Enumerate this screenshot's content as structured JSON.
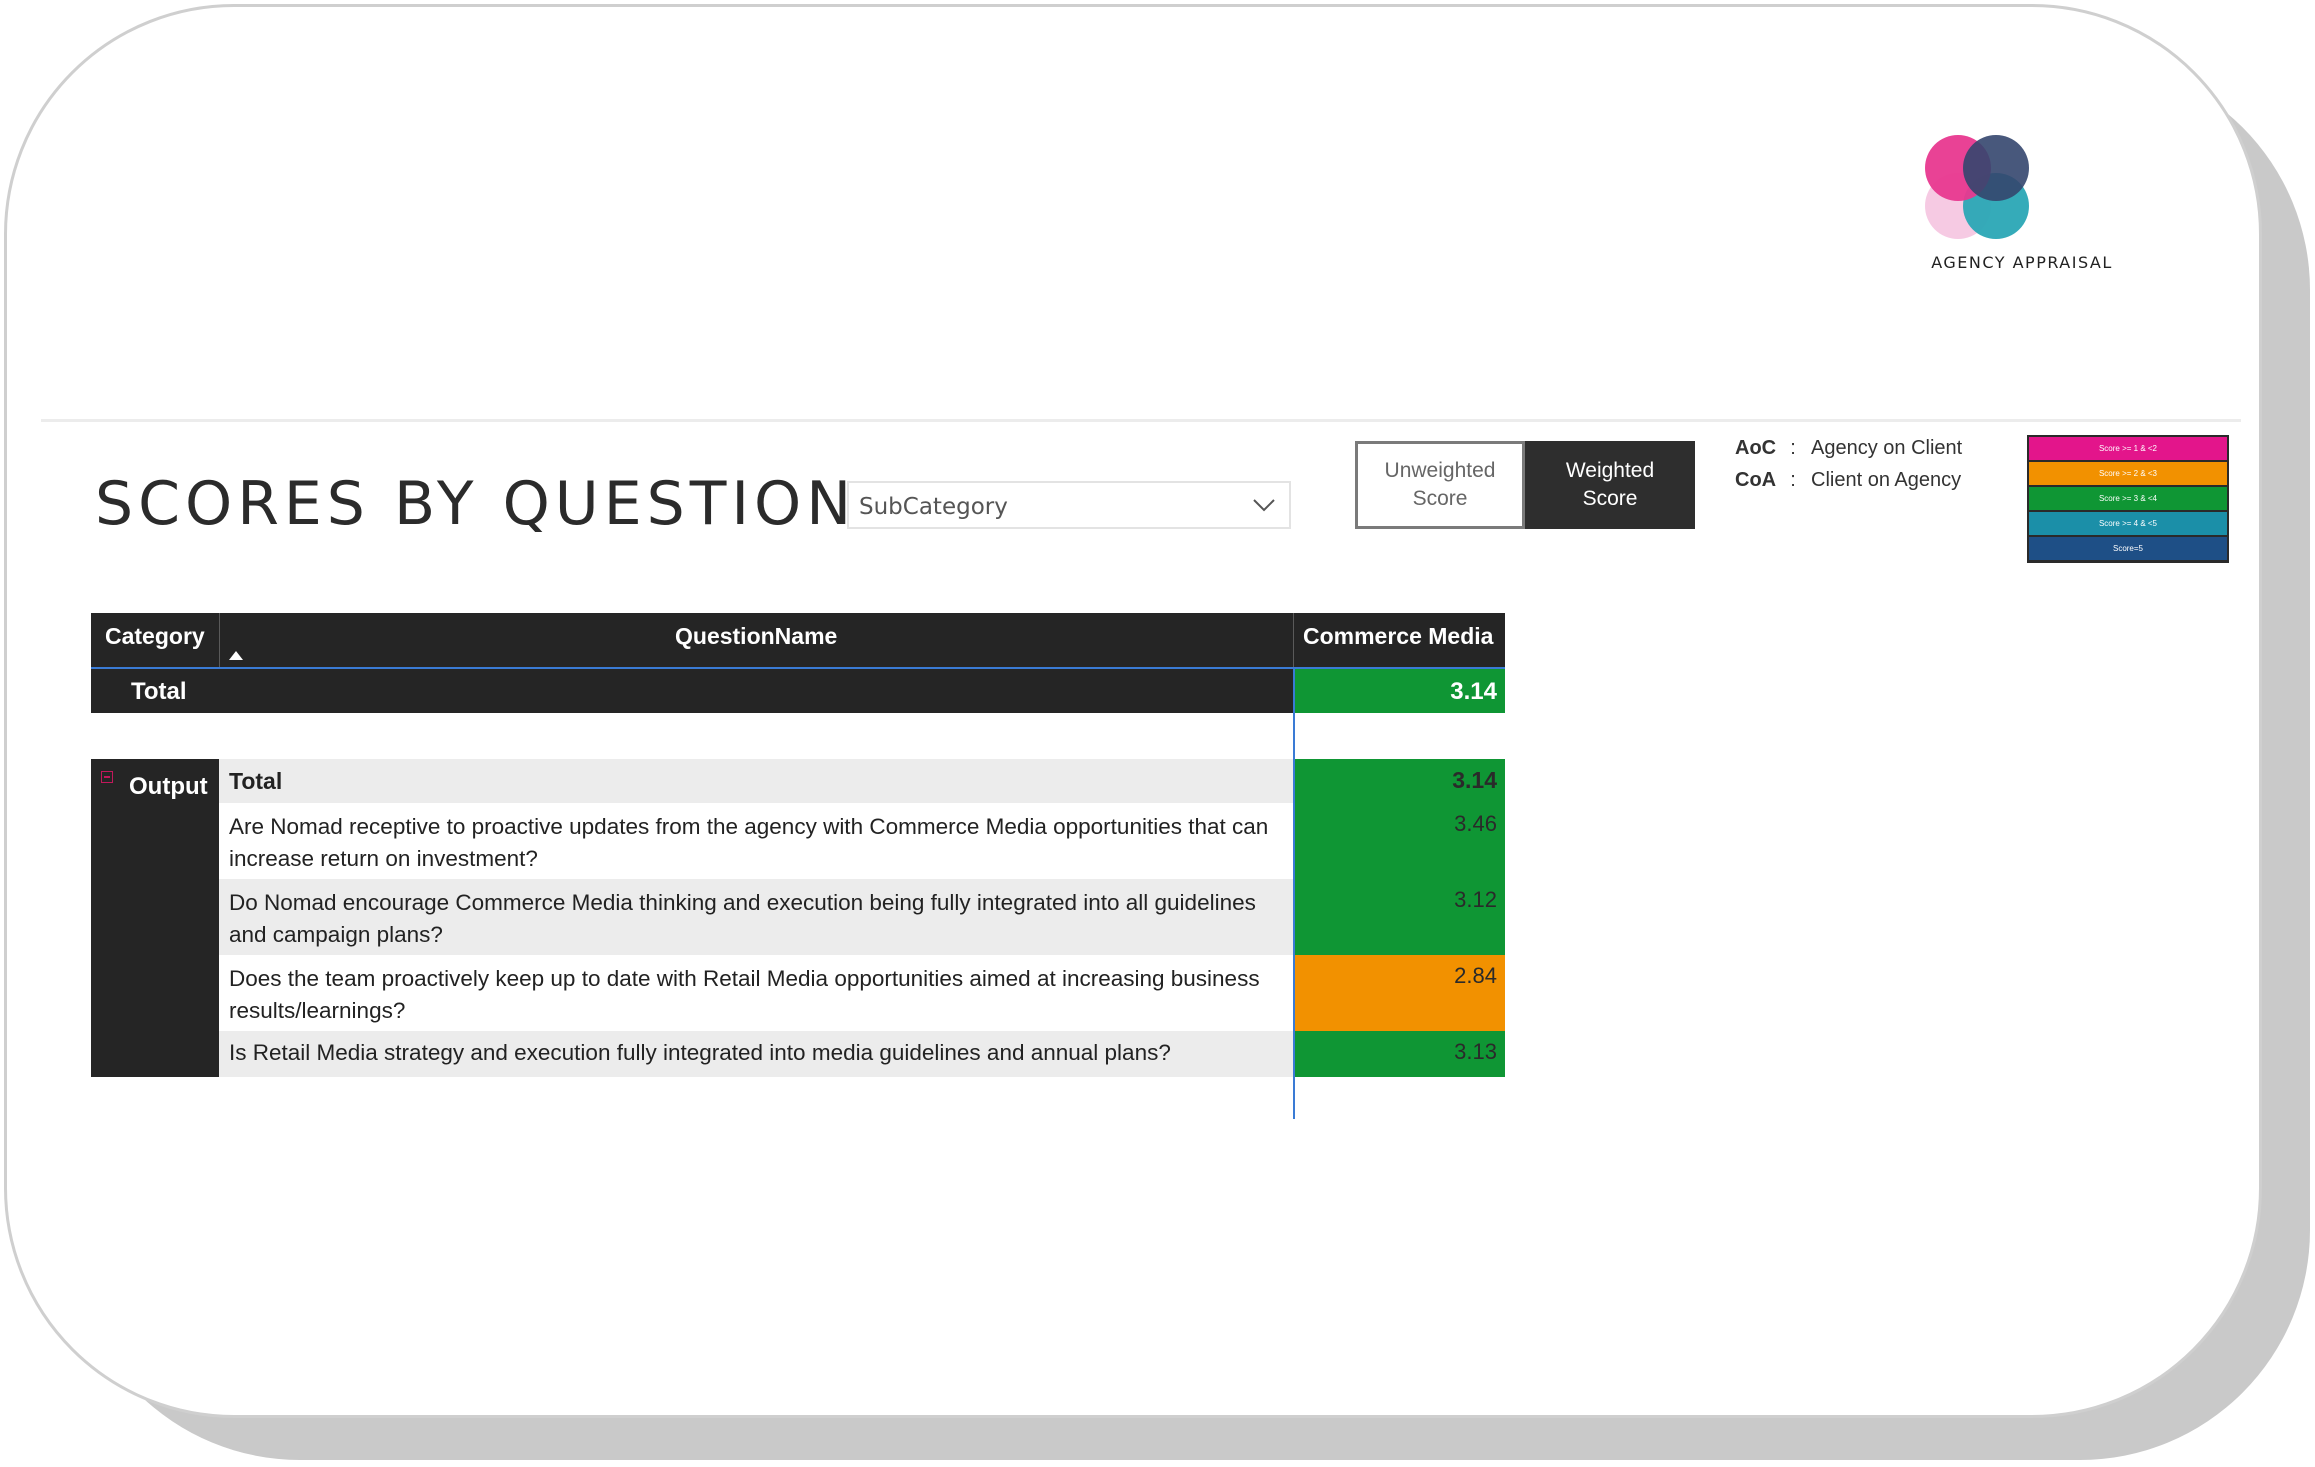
{
  "brand": {
    "logo_text": "AGENCY APPRAISAL",
    "colors": {
      "pink": "#e8388f",
      "navy": "#34466e",
      "light_pink": "#f6c7e2",
      "teal": "#2aa6b5"
    }
  },
  "header": {
    "title": "SCORES BY QUESTION",
    "dropdown_value": "SubCategory"
  },
  "toggle": {
    "unweighted_label": "Unweighted\nScore",
    "weighted_label": "Weighted\nScore",
    "selected": "Weighted Score"
  },
  "abbreviations": [
    {
      "key": "AoC",
      "sep": ":",
      "value": "Agency on Client"
    },
    {
      "key": "CoA",
      "sep": ":",
      "value": "Client on Agency"
    }
  ],
  "score_legend": [
    {
      "label": "Score >= 1 & <2",
      "color": "#e3158b"
    },
    {
      "label": "Score >= 2 & <3",
      "color": "#f29100"
    },
    {
      "label": "Score >= 3 & <4",
      "color": "#0f9634"
    },
    {
      "label": "Score >= 4 & <5",
      "color": "#1b8fa8"
    },
    {
      "label": "Score=5",
      "color": "#1e4f86"
    }
  ],
  "table": {
    "columns": {
      "category": "Category",
      "question": "QuestionName",
      "value": "Commerce Media"
    },
    "grand_total": {
      "label": "Total",
      "value": "3.14"
    },
    "group": {
      "category": "Output",
      "subtotal_label": "Total",
      "subtotal_value": "3.14",
      "rows": [
        {
          "question": "Are Nomad receptive to proactive updates from the agency with Commerce Media opportunities that can increase return on investment?",
          "value": "3.46"
        },
        {
          "question": "Do Nomad encourage Commerce Media thinking and execution being fully integrated into all guidelines and campaign plans?",
          "value": "3.12"
        },
        {
          "question": "Does the team proactively keep up to date with Retail Media opportunities aimed at increasing business results/learnings?",
          "value": "2.84"
        },
        {
          "question": "Is Retail Media strategy and execution fully integrated into media guidelines and annual plans?",
          "value": "3.13"
        }
      ]
    }
  }
}
